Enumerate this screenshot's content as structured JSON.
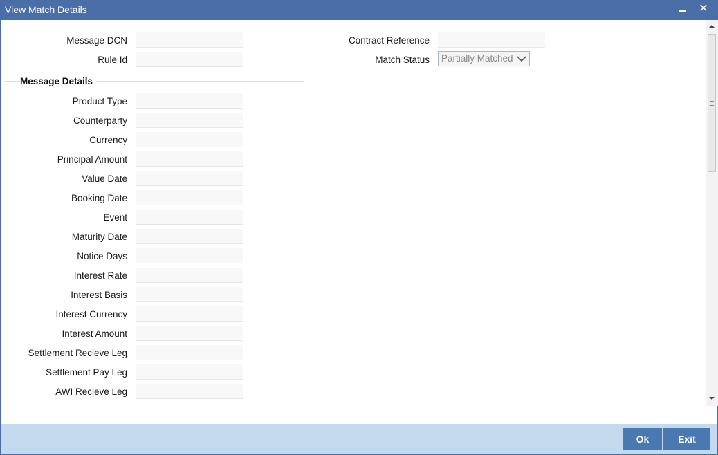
{
  "window": {
    "title": "View Match Details",
    "minimize_icon": "minimize-icon",
    "close_icon": "close-icon",
    "close_glyph": "✕"
  },
  "header": {
    "message_dcn_label": "Message DCN",
    "message_dcn_value": "",
    "rule_id_label": "Rule Id",
    "rule_id_value": "",
    "contract_reference_label": "Contract Reference",
    "contract_reference_value": "",
    "match_status_label": "Match Status",
    "match_status_value": "Partially Matched"
  },
  "message_details": {
    "section_title": "Message Details",
    "fields": [
      {
        "label": "Product Type",
        "value": ""
      },
      {
        "label": "Counterparty",
        "value": ""
      },
      {
        "label": "Currency",
        "value": ""
      },
      {
        "label": "Principal Amount",
        "value": ""
      },
      {
        "label": "Value Date",
        "value": ""
      },
      {
        "label": "Booking Date",
        "value": ""
      },
      {
        "label": "Event",
        "value": ""
      },
      {
        "label": "Maturity Date",
        "value": ""
      },
      {
        "label": "Notice Days",
        "value": ""
      },
      {
        "label": "Interest Rate",
        "value": ""
      },
      {
        "label": "Interest Basis",
        "value": ""
      },
      {
        "label": "Interest Currency",
        "value": ""
      },
      {
        "label": "Interest Amount",
        "value": ""
      },
      {
        "label": "Settlement Recieve Leg",
        "value": ""
      },
      {
        "label": "Settlement Pay Leg",
        "value": ""
      },
      {
        "label": "AWI Recieve Leg",
        "value": ""
      }
    ]
  },
  "footer": {
    "ok_label": "Ok",
    "exit_label": "Exit"
  },
  "colors": {
    "titlebar": "#4a6ea8",
    "footer": "#c3d9ee",
    "button": "#4a79b1"
  }
}
